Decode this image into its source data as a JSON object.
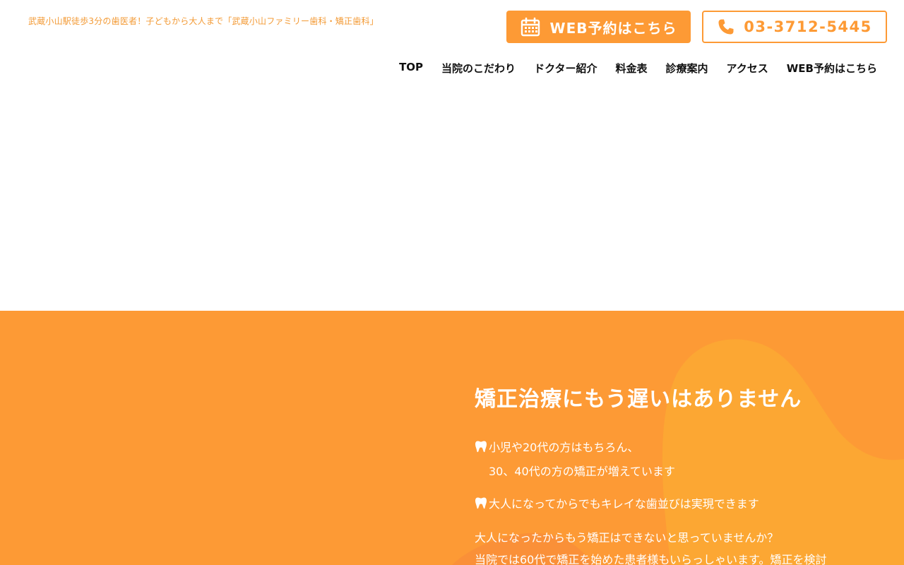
{
  "header": {
    "tagline": "武蔵小山駅徒歩3分の歯医者！子どもから大人まで「武蔵小山ファミリー歯科・矯正歯科」",
    "web_button_label": "WEB予約はこちら",
    "tel_button_label": "03-3712-5445",
    "web_icon": "calendar-icon",
    "tel_icon": "phone-icon"
  },
  "nav": {
    "items": [
      {
        "label": "TOP"
      },
      {
        "label": "当院のこだわり"
      },
      {
        "label": "ドクター紹介"
      },
      {
        "label": "料金表"
      },
      {
        "label": "診療案内"
      },
      {
        "label": "アクセス"
      },
      {
        "label": "WEB予約はこちら"
      }
    ]
  },
  "hero": {
    "title": "矯正治療にもう遅いはありません",
    "bullets": [
      {
        "line1": "小児や20代の方はもちろん、",
        "line2": "30、40代の方の矯正が増えています"
      },
      {
        "line1": "大人になってからでもキレイな歯並びは実現できます"
      }
    ],
    "body_lines": [
      "大人になったからもう矯正はできないと思っていませんか？",
      "当院では60代で矯正を始めた患者様もいらっしゃいます。矯正を検討"
    ]
  },
  "colors": {
    "accent": "#fd9a35",
    "accent_light": "#fca733",
    "text_dark": "#111111",
    "white": "#ffffff"
  }
}
